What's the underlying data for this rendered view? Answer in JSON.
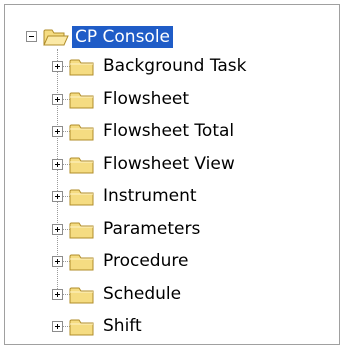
{
  "tree": {
    "root": {
      "label": "CP Console",
      "expanded": true,
      "selected": true,
      "icon": "open-folder-icon",
      "expander": "minus-icon"
    },
    "children": [
      {
        "label": "Background Task",
        "expander": "plus-icon",
        "icon": "folder-icon"
      },
      {
        "label": "Flowsheet",
        "expander": "plus-icon",
        "icon": "folder-icon"
      },
      {
        "label": "Flowsheet Total",
        "expander": "plus-icon",
        "icon": "folder-icon"
      },
      {
        "label": "Flowsheet View",
        "expander": "plus-icon",
        "icon": "folder-icon"
      },
      {
        "label": "Instrument",
        "expander": "plus-icon",
        "icon": "folder-icon"
      },
      {
        "label": "Parameters",
        "expander": "plus-icon",
        "icon": "folder-icon"
      },
      {
        "label": "Procedure",
        "expander": "plus-icon",
        "icon": "folder-icon"
      },
      {
        "label": "Schedule",
        "expander": "plus-icon",
        "icon": "folder-icon"
      },
      {
        "label": "Shift",
        "expander": "plus-icon",
        "icon": "folder-icon"
      }
    ]
  },
  "colors": {
    "selection": "#1f5cc7",
    "folder_fill": "#f5dc82",
    "folder_stroke": "#b08d2a"
  }
}
